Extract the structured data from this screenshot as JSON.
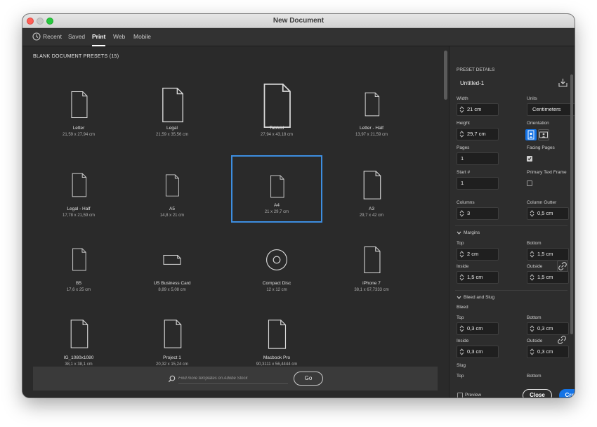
{
  "window": {
    "title": "New Document"
  },
  "tabs": [
    {
      "label": "Recent"
    },
    {
      "label": "Saved"
    },
    {
      "label": "Print"
    },
    {
      "label": "Web"
    },
    {
      "label": "Mobile"
    }
  ],
  "active_tab": "Print",
  "presets": {
    "title": "BLANK DOCUMENT PRESETS",
    "count": "(15)",
    "items": [
      {
        "name": "Letter",
        "size": "21,59 x 27,94 cm",
        "icon": "page-icon"
      },
      {
        "name": "Legal",
        "size": "21,59 x 35,56 cm",
        "icon": "page-icon"
      },
      {
        "name": "Tabloid",
        "size": "27,94 x 43,18 cm",
        "icon": "page-icon"
      },
      {
        "name": "Letter - Half",
        "size": "13,97 x 21,59 cm",
        "icon": "page-icon"
      },
      {
        "name": "Legal - Half",
        "size": "17,78 x 21,59 cm",
        "icon": "page-icon"
      },
      {
        "name": "A5",
        "size": "14,8 x 21 cm",
        "icon": "page-icon"
      },
      {
        "name": "A4",
        "size": "21 x 29,7 cm",
        "icon": "page-icon",
        "selected": true
      },
      {
        "name": "A3",
        "size": "29,7 x 42 cm",
        "icon": "page-icon"
      },
      {
        "name": "B5",
        "size": "17,6 x 25 cm",
        "icon": "page-icon"
      },
      {
        "name": "US Business Card",
        "size": "8,89 x 5,08 cm",
        "icon": "card-icon"
      },
      {
        "name": "Compact Disc",
        "size": "12 x 12 cm",
        "icon": "disc-icon"
      },
      {
        "name": "iPhone 7",
        "size": "38,1 x 67,7333 cm",
        "icon": "page-icon"
      },
      {
        "name": "IG_1080x1080",
        "size": "38,1 x 38,1 cm",
        "icon": "page-icon"
      },
      {
        "name": "Project 1",
        "size": "20,32 x 15,24 cm",
        "icon": "page-icon"
      },
      {
        "name": "Macbook Pro",
        "size": "90,3111 x 56,4444 cm",
        "icon": "page-icon"
      }
    ]
  },
  "search": {
    "placeholder": "Find more templates on Adobe Stock",
    "go_label": "Go"
  },
  "details": {
    "header": "PRESET DETAILS",
    "name": "Untitled-1",
    "width_label": "Width",
    "width": "21 cm",
    "units_label": "Units",
    "units": "Centimeters",
    "height_label": "Height",
    "height": "29,7 cm",
    "orientation_label": "Orientation",
    "pages_label": "Pages",
    "pages": "1",
    "facing_label": "Facing Pages",
    "facing_checked": true,
    "start_label": "Start #",
    "start": "1",
    "ptf_label": "Primary Text Frame",
    "ptf_checked": false,
    "columns_label": "Columns",
    "columns": "3",
    "gutter_label": "Column Gutter",
    "gutter": "0,5 cm",
    "margins_label": "Margins",
    "margin_top_label": "Top",
    "margin_top": "2 cm",
    "margin_bottom_label": "Bottom",
    "margin_bottom": "1,5 cm",
    "margin_inside_label": "Inside",
    "margin_inside": "1,5 cm",
    "margin_outside_label": "Outside",
    "margin_outside": "1,5 cm",
    "bleed_slug_label": "Bleed and Slug",
    "bleed_label": "Bleed",
    "bleed_top_label": "Top",
    "bleed_top": "0,3 cm",
    "bleed_bottom_label": "Bottom",
    "bleed_bottom": "0,3 cm",
    "bleed_inside_label": "Inside",
    "bleed_inside": "0,3 cm",
    "bleed_outside_label": "Outside",
    "bleed_outside": "0,3 cm",
    "slug_label": "Slug",
    "slug_top_label": "Top",
    "slug_bottom_label": "Bottom",
    "preview_label": "Preview",
    "preview_checked": false
  },
  "actions": {
    "close": "Close",
    "create": "Create"
  },
  "colors": {
    "accent": "#1473e6",
    "selection": "#3d8ee0",
    "background": "#2a2a2a"
  }
}
